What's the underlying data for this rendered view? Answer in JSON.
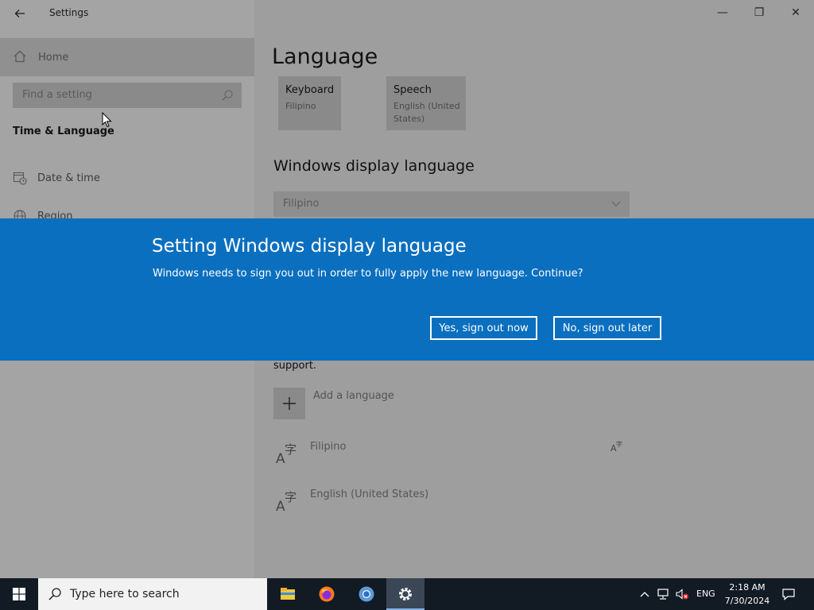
{
  "window": {
    "title": "Settings",
    "controls": {
      "minimize": "—",
      "maximize": "❐",
      "close": "✕"
    }
  },
  "sidebar": {
    "home_label": "Home",
    "search_placeholder": "Find a setting",
    "section_title": "Time & Language",
    "items": [
      {
        "label": "Date & time",
        "icon": "calendar-clock-icon"
      },
      {
        "label": "Region",
        "icon": "globe-icon"
      }
    ]
  },
  "main": {
    "page_title": "Language",
    "tiles": [
      {
        "title": "Keyboard",
        "subtitle": "Filipino"
      },
      {
        "title": "Speech",
        "subtitle": "English (United States)"
      }
    ],
    "display_language": {
      "heading": "Windows display language",
      "value": "Filipino"
    },
    "support_text": "support.",
    "add_language_label": "Add a language",
    "languages": [
      {
        "label": "Filipino",
        "icon": "language-icon"
      },
      {
        "label": "English (United States)",
        "icon": "language-icon"
      }
    ]
  },
  "dialog": {
    "title": "Setting Windows display language",
    "message": "Windows needs to sign you out in order to fully apply the new language. Continue?",
    "yes_label": "Yes, sign out now",
    "no_label": "No, sign out later",
    "background": "#0a6fbf"
  },
  "taskbar": {
    "search_placeholder": "Type here to search",
    "apps": [
      "file-explorer-icon",
      "firefox-icon",
      "chrome-icon",
      "settings-gear-icon"
    ],
    "language": "ENG",
    "time": "2:18 AM",
    "date": "7/30/2024"
  }
}
